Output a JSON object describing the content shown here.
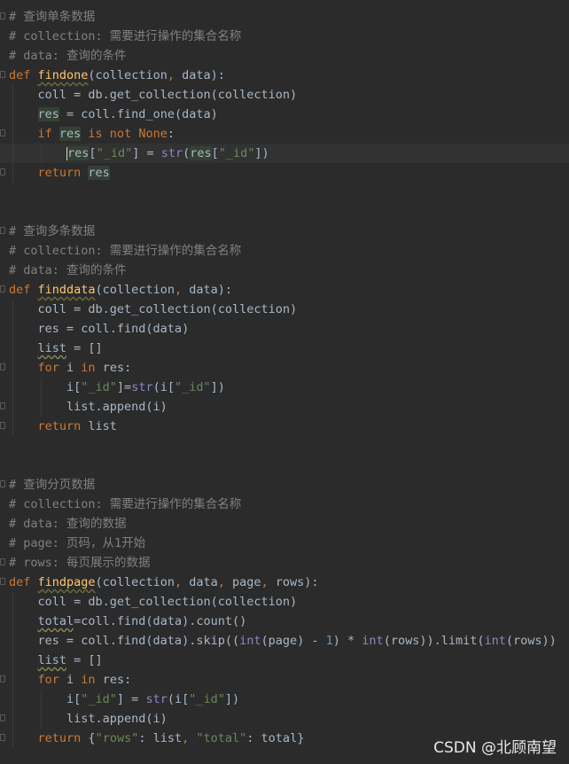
{
  "colors": {
    "background": "#2b2b2b",
    "default_text": "#a9b7c6",
    "comment": "#808080",
    "keyword": "#cc7832",
    "function_name": "#ffc66d",
    "string": "#6a8759",
    "number": "#6897bb",
    "builtin": "#8888c6",
    "current_line": "#323232"
  },
  "watermark": "CSDN @北顾南望",
  "lines": [
    {
      "fold": true,
      "current": false,
      "tokens": [
        {
          "c": "comment",
          "t": "# 查询单条数据"
        }
      ]
    },
    {
      "fold": false,
      "current": false,
      "tokens": [
        {
          "c": "comment",
          "t": "# collection: 需要进行操作的集合名称"
        }
      ]
    },
    {
      "fold": false,
      "current": false,
      "tokens": [
        {
          "c": "comment",
          "t": "# data: 查询的条件"
        }
      ]
    },
    {
      "fold": true,
      "current": false,
      "tokens": [
        {
          "c": "kw",
          "t": "def "
        },
        {
          "c": "fn",
          "t": "findone"
        },
        {
          "c": "",
          "t": "(collection"
        },
        {
          "c": "kw",
          "t": ", "
        },
        {
          "c": "",
          "t": "data):"
        }
      ]
    },
    {
      "fold": false,
      "current": false,
      "guides": [
        1
      ],
      "tokens": [
        {
          "c": "",
          "t": "    coll = db.get_collection(collection)"
        }
      ]
    },
    {
      "fold": false,
      "current": false,
      "guides": [
        1
      ],
      "tokens": [
        {
          "c": "",
          "t": "    "
        },
        {
          "c": "hl",
          "t": "res"
        },
        {
          "c": "",
          "t": " = coll.find_one(data)"
        }
      ]
    },
    {
      "fold": true,
      "current": false,
      "guides": [
        1
      ],
      "tokens": [
        {
          "c": "",
          "t": "    "
        },
        {
          "c": "kw",
          "t": "if "
        },
        {
          "c": "hl",
          "t": "res"
        },
        {
          "c": "kw",
          "t": " is not None"
        },
        {
          "c": "",
          "t": ":"
        }
      ]
    },
    {
      "fold": false,
      "current": true,
      "caret": true,
      "guides": [
        1,
        2
      ],
      "tokens": [
        {
          "c": "",
          "t": "        "
        },
        {
          "c": "caret",
          "t": ""
        },
        {
          "c": "hl",
          "t": "res"
        },
        {
          "c": "",
          "t": "["
        },
        {
          "c": "str",
          "t": "\"_id\""
        },
        {
          "c": "",
          "t": "] = "
        },
        {
          "c": "bi",
          "t": "str"
        },
        {
          "c": "",
          "t": "("
        },
        {
          "c": "hl",
          "t": "res"
        },
        {
          "c": "",
          "t": "["
        },
        {
          "c": "str",
          "t": "\"_id\""
        },
        {
          "c": "",
          "t": "])"
        }
      ]
    },
    {
      "fold": true,
      "current": false,
      "guides": [
        1
      ],
      "tokens": [
        {
          "c": "",
          "t": "    "
        },
        {
          "c": "kw",
          "t": "return "
        },
        {
          "c": "hl",
          "t": "res"
        }
      ]
    },
    {
      "fold": false,
      "current": false,
      "tokens": []
    },
    {
      "fold": false,
      "current": false,
      "tokens": []
    },
    {
      "fold": true,
      "current": false,
      "tokens": [
        {
          "c": "comment",
          "t": "# 查询多条数据"
        }
      ]
    },
    {
      "fold": false,
      "current": false,
      "tokens": [
        {
          "c": "comment",
          "t": "# collection: 需要进行操作的集合名称"
        }
      ]
    },
    {
      "fold": false,
      "current": false,
      "tokens": [
        {
          "c": "comment",
          "t": "# data: 查询的条件"
        }
      ]
    },
    {
      "fold": true,
      "current": false,
      "tokens": [
        {
          "c": "kw",
          "t": "def "
        },
        {
          "c": "fn",
          "t": "finddata"
        },
        {
          "c": "",
          "t": "(collection"
        },
        {
          "c": "kw",
          "t": ", "
        },
        {
          "c": "",
          "t": "data):"
        }
      ]
    },
    {
      "fold": false,
      "current": false,
      "guides": [
        1
      ],
      "tokens": [
        {
          "c": "",
          "t": "    coll = db.get_collection(collection)"
        }
      ]
    },
    {
      "fold": false,
      "current": false,
      "guides": [
        1
      ],
      "tokens": [
        {
          "c": "",
          "t": "    res = coll.find(data)"
        }
      ]
    },
    {
      "fold": false,
      "current": false,
      "guides": [
        1
      ],
      "tokens": [
        {
          "c": "",
          "t": "    "
        },
        {
          "c": "warn",
          "t": "list"
        },
        {
          "c": "",
          "t": " = []"
        }
      ]
    },
    {
      "fold": true,
      "current": false,
      "guides": [
        1
      ],
      "tokens": [
        {
          "c": "",
          "t": "    "
        },
        {
          "c": "kw",
          "t": "for "
        },
        {
          "c": "",
          "t": "i "
        },
        {
          "c": "kw",
          "t": "in "
        },
        {
          "c": "",
          "t": "res:"
        }
      ]
    },
    {
      "fold": false,
      "current": false,
      "guides": [
        1,
        2
      ],
      "tokens": [
        {
          "c": "",
          "t": "        i["
        },
        {
          "c": "str",
          "t": "\"_id\""
        },
        {
          "c": "",
          "t": "]="
        },
        {
          "c": "bi",
          "t": "str"
        },
        {
          "c": "",
          "t": "(i["
        },
        {
          "c": "str",
          "t": "\"_id\""
        },
        {
          "c": "",
          "t": "])"
        }
      ]
    },
    {
      "fold": true,
      "current": false,
      "guides": [
        1,
        2
      ],
      "tokens": [
        {
          "c": "",
          "t": "        list.append(i)"
        }
      ]
    },
    {
      "fold": true,
      "current": false,
      "guides": [
        1
      ],
      "tokens": [
        {
          "c": "",
          "t": "    "
        },
        {
          "c": "kw",
          "t": "return "
        },
        {
          "c": "",
          "t": "list"
        }
      ]
    },
    {
      "fold": false,
      "current": false,
      "tokens": []
    },
    {
      "fold": false,
      "current": false,
      "tokens": []
    },
    {
      "fold": true,
      "current": false,
      "tokens": [
        {
          "c": "comment",
          "t": "# 查询分页数据"
        }
      ]
    },
    {
      "fold": false,
      "current": false,
      "tokens": [
        {
          "c": "comment",
          "t": "# collection: 需要进行操作的集合名称"
        }
      ]
    },
    {
      "fold": false,
      "current": false,
      "tokens": [
        {
          "c": "comment",
          "t": "# data: 查询的数据"
        }
      ]
    },
    {
      "fold": false,
      "current": false,
      "tokens": [
        {
          "c": "comment",
          "t": "# page: 页码，从1开始"
        }
      ]
    },
    {
      "fold": true,
      "current": false,
      "tokens": [
        {
          "c": "comment",
          "t": "# rows: 每页展示的数据"
        }
      ]
    },
    {
      "fold": true,
      "current": false,
      "tokens": [
        {
          "c": "kw",
          "t": "def "
        },
        {
          "c": "fn",
          "t": "findpage"
        },
        {
          "c": "",
          "t": "(collection"
        },
        {
          "c": "kw",
          "t": ", "
        },
        {
          "c": "",
          "t": "data"
        },
        {
          "c": "kw",
          "t": ", "
        },
        {
          "c": "",
          "t": "page"
        },
        {
          "c": "kw",
          "t": ", "
        },
        {
          "c": "",
          "t": "rows):"
        }
      ]
    },
    {
      "fold": false,
      "current": false,
      "guides": [
        1
      ],
      "tokens": [
        {
          "c": "",
          "t": "    coll = db.get_collection(collection)"
        }
      ]
    },
    {
      "fold": false,
      "current": false,
      "guides": [
        1
      ],
      "tokens": [
        {
          "c": "",
          "t": "    "
        },
        {
          "c": "warn",
          "t": "total"
        },
        {
          "c": "",
          "t": "=coll.find(data).count()"
        }
      ]
    },
    {
      "fold": false,
      "current": false,
      "guides": [
        1
      ],
      "tokens": [
        {
          "c": "",
          "t": "    res = coll.find(data).skip(("
        },
        {
          "c": "bi",
          "t": "int"
        },
        {
          "c": "",
          "t": "(page) - "
        },
        {
          "c": "num",
          "t": "1"
        },
        {
          "c": "",
          "t": ") * "
        },
        {
          "c": "bi",
          "t": "int"
        },
        {
          "c": "",
          "t": "(rows)).limit("
        },
        {
          "c": "bi",
          "t": "int"
        },
        {
          "c": "",
          "t": "(rows))"
        }
      ]
    },
    {
      "fold": false,
      "current": false,
      "guides": [
        1
      ],
      "tokens": [
        {
          "c": "",
          "t": "    "
        },
        {
          "c": "warn",
          "t": "list"
        },
        {
          "c": "",
          "t": " = []"
        }
      ]
    },
    {
      "fold": true,
      "current": false,
      "guides": [
        1
      ],
      "tokens": [
        {
          "c": "",
          "t": "    "
        },
        {
          "c": "kw",
          "t": "for "
        },
        {
          "c": "",
          "t": "i "
        },
        {
          "c": "kw",
          "t": "in "
        },
        {
          "c": "",
          "t": "res:"
        }
      ]
    },
    {
      "fold": false,
      "current": false,
      "guides": [
        1,
        2
      ],
      "tokens": [
        {
          "c": "",
          "t": "        i["
        },
        {
          "c": "str",
          "t": "\"_id\""
        },
        {
          "c": "",
          "t": "] = "
        },
        {
          "c": "bi",
          "t": "str"
        },
        {
          "c": "",
          "t": "(i["
        },
        {
          "c": "str",
          "t": "\"_id\""
        },
        {
          "c": "",
          "t": "])"
        }
      ]
    },
    {
      "fold": true,
      "current": false,
      "guides": [
        1,
        2
      ],
      "tokens": [
        {
          "c": "",
          "t": "        list.append(i)"
        }
      ]
    },
    {
      "fold": true,
      "current": false,
      "guides": [
        1
      ],
      "tokens": [
        {
          "c": "",
          "t": "    "
        },
        {
          "c": "kw",
          "t": "return "
        },
        {
          "c": "",
          "t": "{"
        },
        {
          "c": "str",
          "t": "\"rows\""
        },
        {
          "c": "",
          "t": ": list"
        },
        {
          "c": "kw",
          "t": ", "
        },
        {
          "c": "str",
          "t": "\"total\""
        },
        {
          "c": "",
          "t": ": total}"
        }
      ]
    }
  ]
}
